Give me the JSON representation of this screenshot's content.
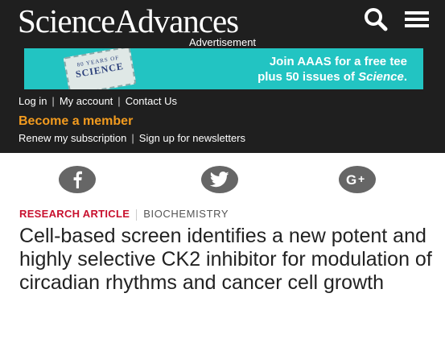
{
  "header": {
    "brand": "ScienceAdvances",
    "search_icon": "search-icon",
    "menu_icon": "hamburger-menu-icon"
  },
  "ad": {
    "label": "Advertisement",
    "stamp_top": "80 YEARS OF",
    "stamp_main": "SCIENCE",
    "line1": "Join AAAS for a free tee",
    "line2_prefix": "plus 50 issues of ",
    "line2_em": "Science",
    "line2_suffix": ".",
    "bg_color": "#22c4c2"
  },
  "account_links": [
    {
      "label": "Log in"
    },
    {
      "label": "My account"
    },
    {
      "label": "Contact Us"
    }
  ],
  "become_member": "Become a member",
  "member_links": [
    {
      "label": "Renew my subscription"
    },
    {
      "label": "Sign up for newsletters"
    }
  ],
  "share": [
    {
      "icon": "facebook-icon"
    },
    {
      "icon": "twitter-icon"
    },
    {
      "icon": "google-plus-icon"
    }
  ],
  "article": {
    "type": "RESEARCH ARTICLE",
    "subject": "BIOCHEMISTRY",
    "title": "Cell-based screen identifies a new potent and highly selective CK2 inhibitor for modulation of circadian rhythms and cancer cell growth"
  },
  "colors": {
    "header_bg": "#1f1f1f",
    "accent_orange": "#f29b1f",
    "kicker_red": "#c8102e",
    "share_gray": "#666666"
  }
}
